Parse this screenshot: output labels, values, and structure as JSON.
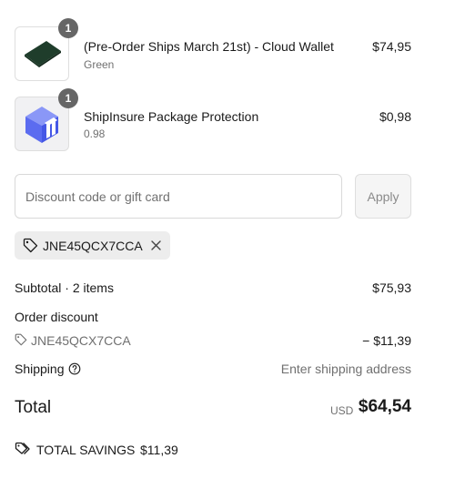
{
  "line_items": [
    {
      "quantity": "1",
      "title": "(Pre-Order Ships March 21st) - Cloud Wallet",
      "variant": "Green",
      "price": "$74,95",
      "image_icon": "green-wallet-image"
    },
    {
      "quantity": "1",
      "title": "ShipInsure Package Protection",
      "variant": "0.98",
      "price": "$0,98",
      "image_icon": "package-protection-house-icon"
    }
  ],
  "discount": {
    "placeholder": "Discount code or gift card",
    "value": "",
    "apply_label": "Apply",
    "applied_code": "JNE45QCX7CCA"
  },
  "summary": {
    "subtotal_label": "Subtotal · 2 items",
    "subtotal_value": "$75,93",
    "order_discount_label": "Order discount",
    "order_discount_code": "JNE45QCX7CCA",
    "order_discount_value": "− $11,39",
    "shipping_label": "Shipping",
    "shipping_value": "Enter shipping address",
    "total_label": "Total",
    "currency": "USD",
    "total_value": "$64,54",
    "total_savings_label": "TOTAL SAVINGS",
    "total_savings_value": "$11,39"
  },
  "colors": {
    "badge": "#666666",
    "wallet_green": "#1f3d2b",
    "protection_blue": "#5b6cf0",
    "muted_text": "#707070"
  }
}
